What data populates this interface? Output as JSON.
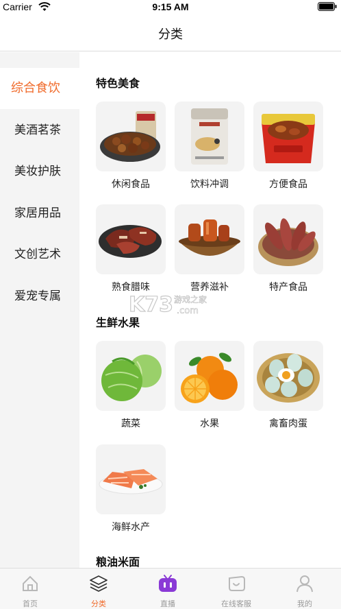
{
  "status_bar": {
    "carrier": "Carrier",
    "time": "9:15 AM"
  },
  "nav": {
    "title": "分类"
  },
  "sidebar": {
    "items": [
      {
        "label": "综合食饮",
        "active": true
      },
      {
        "label": "美酒茗茶",
        "active": false
      },
      {
        "label": "美妆护肤",
        "active": false
      },
      {
        "label": "家居用品",
        "active": false
      },
      {
        "label": "文创艺术",
        "active": false
      },
      {
        "label": "爱宠专属",
        "active": false
      }
    ]
  },
  "sections": [
    {
      "title": "特色美食",
      "items": [
        {
          "label": "休闲食品",
          "icon": "jerky-snack-image"
        },
        {
          "label": "饮料冲调",
          "icon": "oat-drink-package-image"
        },
        {
          "label": "方便食品",
          "icon": "instant-noodle-bowl-image"
        },
        {
          "label": "熟食腊味",
          "icon": "cured-meat-image"
        },
        {
          "label": "营养滋补",
          "icon": "jelly-dessert-bowl-image"
        },
        {
          "label": "特产食品",
          "icon": "sweet-potato-basket-image"
        }
      ]
    },
    {
      "title": "生鲜水果",
      "items": [
        {
          "label": "蔬菜",
          "icon": "cabbage-image"
        },
        {
          "label": "水果",
          "icon": "orange-fruit-image"
        },
        {
          "label": "禽畜肉蛋",
          "icon": "duck-eggs-basket-image"
        },
        {
          "label": "海鲜水产",
          "icon": "salmon-plate-image"
        }
      ]
    },
    {
      "title": "粮油米面",
      "items": []
    }
  ],
  "watermark": {
    "text": "K73 游戏之家 .com"
  },
  "tab_bar": {
    "tabs": [
      {
        "label": "首页",
        "icon": "home-icon",
        "active": false
      },
      {
        "label": "分类",
        "icon": "category-layers-icon",
        "active": true
      },
      {
        "label": "直播",
        "icon": "tv-live-icon",
        "active": false
      },
      {
        "label": "在线客服",
        "icon": "chat-service-icon",
        "active": false
      },
      {
        "label": "我的",
        "icon": "profile-icon",
        "active": false
      }
    ]
  },
  "colors": {
    "accent": "#f06a2a",
    "live_icon": "#8a3ad6",
    "sidebar_bg": "#f4f4f4",
    "tile_bg": "#f3f3f3"
  }
}
